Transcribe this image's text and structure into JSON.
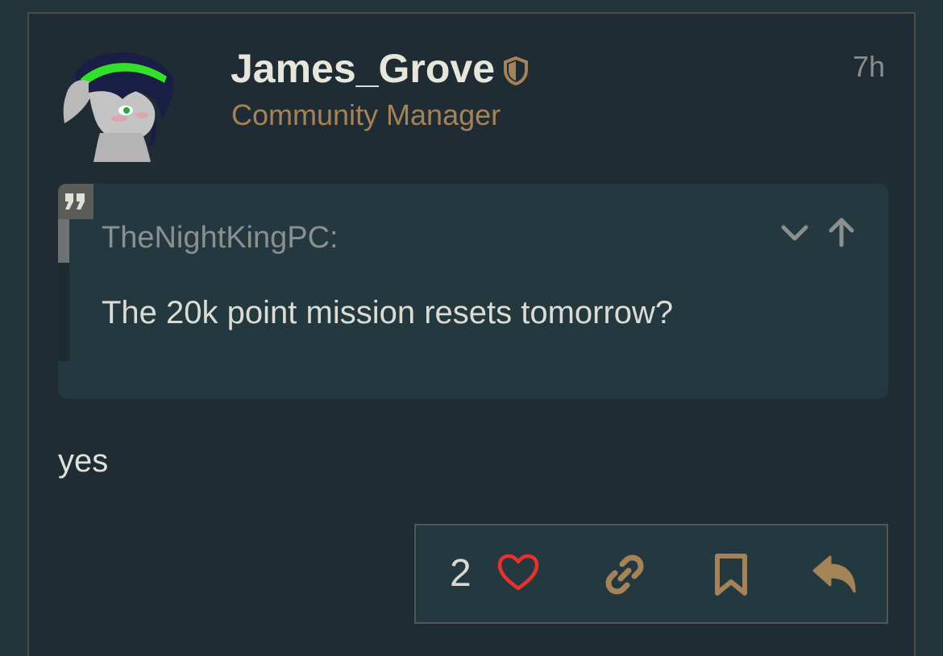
{
  "post": {
    "author": {
      "username": "James_Grove",
      "title": "Community Manager",
      "badge_icon": "shield-icon",
      "avatar_icon": "avatar-pony-character"
    },
    "timestamp": "7h",
    "quote": {
      "icon": "quote-icon",
      "author": "TheNightKingPC:",
      "text": "The 20k point mission resets tomorrow?",
      "expand_icon": "chevron-down-icon",
      "jump_icon": "arrow-up-icon"
    },
    "body": "yes",
    "actions": {
      "like_count": "2",
      "like_icon": "heart-icon",
      "link_icon": "link-icon",
      "bookmark_icon": "bookmark-icon",
      "reply_icon": "reply-icon"
    }
  },
  "colors": {
    "background": "#22333a",
    "post_background": "#1f2c33",
    "accent": "#a68357",
    "heart": "#e8322c",
    "quote_background": "#243840"
  }
}
